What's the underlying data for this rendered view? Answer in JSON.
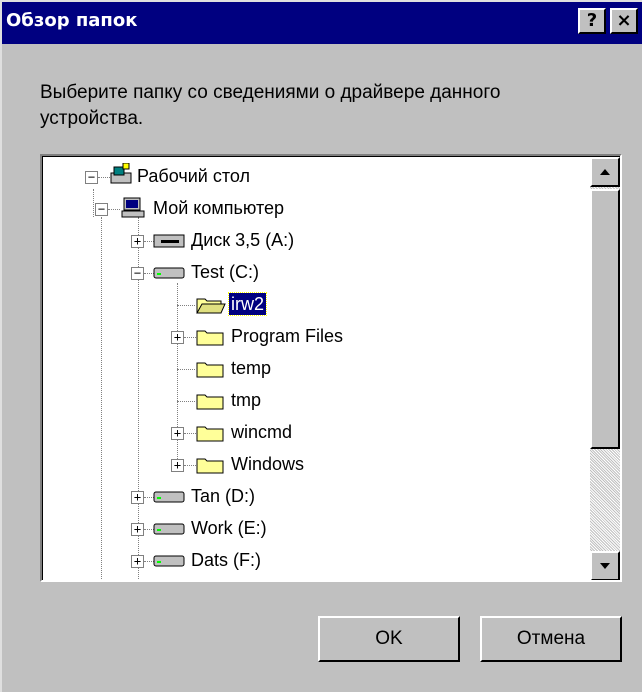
{
  "window": {
    "title": "Обзор папок",
    "help_button": "?",
    "close_button": "×"
  },
  "prompt": {
    "line1": "Выберите папку со сведениями о драйвере данного",
    "line2": "устройства."
  },
  "tree": {
    "desktop": "Рабочий стол",
    "my_computer": "Мой компьютер",
    "items": [
      "Диск 3,5 (A:)",
      "Test (C:)",
      "irw2",
      "Program Files",
      "temp",
      "tmp",
      "wincmd",
      "Windows",
      "Tan (D:)",
      "Work (E:)",
      "Dats (F:)"
    ],
    "expanders": {
      "plus": "+",
      "minus": "−"
    }
  },
  "buttons": {
    "ok": "OK",
    "cancel": "Отмена"
  },
  "colors": {
    "titlebar": "#000080",
    "face": "#c0c0c0",
    "selection": "#000080",
    "folder": "#ffff99"
  }
}
